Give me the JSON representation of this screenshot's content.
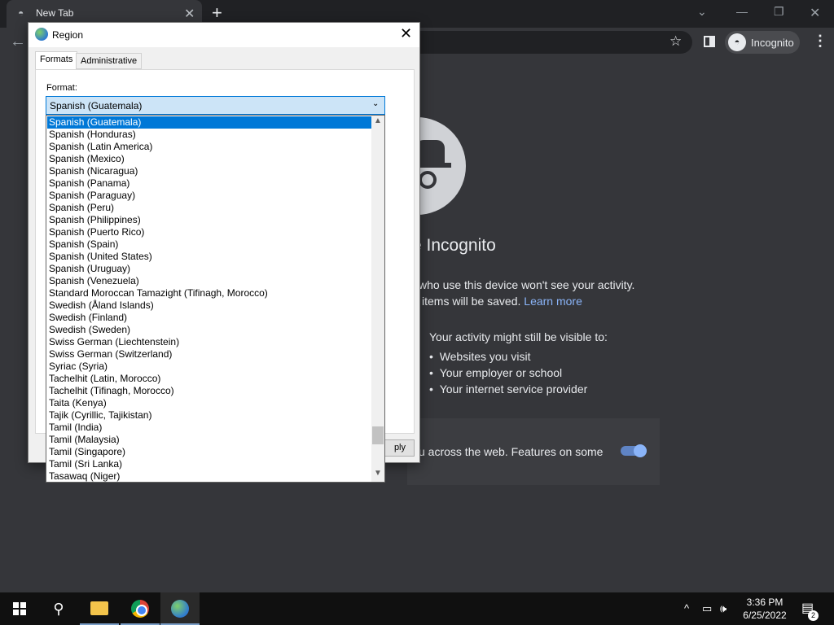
{
  "browser": {
    "tab_title": "New Tab",
    "tab_close": "✕",
    "new_tab": "+",
    "profile_label": "Incognito",
    "menu": "⋮"
  },
  "incognito_page": {
    "heading": "e Incognito",
    "line1": "who use this device won't see your activity.",
    "line2": "items will be saved.",
    "learn_more": "Learn more",
    "visible_heading": "Your activity might still be visible to:",
    "bullets": [
      "Websites you visit",
      "Your employer or school",
      "Your internet service provider"
    ],
    "cookie_text": "u across the web. Features on some"
  },
  "dialog": {
    "title": "Region",
    "close": "✕",
    "tabs": [
      "Formats",
      "Administrative"
    ],
    "format_label": "Format:",
    "apply_label": "ply"
  },
  "format_combo": {
    "value": "Spanish (Guatemala)"
  },
  "format_list": {
    "items": [
      "Spanish (Guatemala)",
      "Spanish (Honduras)",
      "Spanish (Latin America)",
      "Spanish (Mexico)",
      "Spanish (Nicaragua)",
      "Spanish (Panama)",
      "Spanish (Paraguay)",
      "Spanish (Peru)",
      "Spanish (Philippines)",
      "Spanish (Puerto Rico)",
      "Spanish (Spain)",
      "Spanish (United States)",
      "Spanish (Uruguay)",
      "Spanish (Venezuela)",
      "Standard Moroccan Tamazight (Tifinagh, Morocco)",
      "Swedish (Åland Islands)",
      "Swedish (Finland)",
      "Swedish (Sweden)",
      "Swiss German (Liechtenstein)",
      "Swiss German (Switzerland)",
      "Syriac (Syria)",
      "Tachelhit (Latin, Morocco)",
      "Tachelhit (Tifinagh, Morocco)",
      "Taita (Kenya)",
      "Tajik (Cyrillic, Tajikistan)",
      "Tamil (India)",
      "Tamil (Malaysia)",
      "Tamil (Singapore)",
      "Tamil (Sri Lanka)",
      "Tasawaq (Niger)"
    ],
    "selected_index": 0
  },
  "taskbar": {
    "time": "3:36 PM",
    "date": "6/25/2022",
    "notification_count": "2"
  },
  "icons": {
    "incognito": "incognito-icon",
    "star": "star-icon",
    "back": "back-arrow-icon",
    "search": "search-icon",
    "region": "region-globe-icon"
  },
  "colors": {
    "selection": "#0078d7",
    "link": "#8ab4f8",
    "page_bg": "#35363a"
  }
}
